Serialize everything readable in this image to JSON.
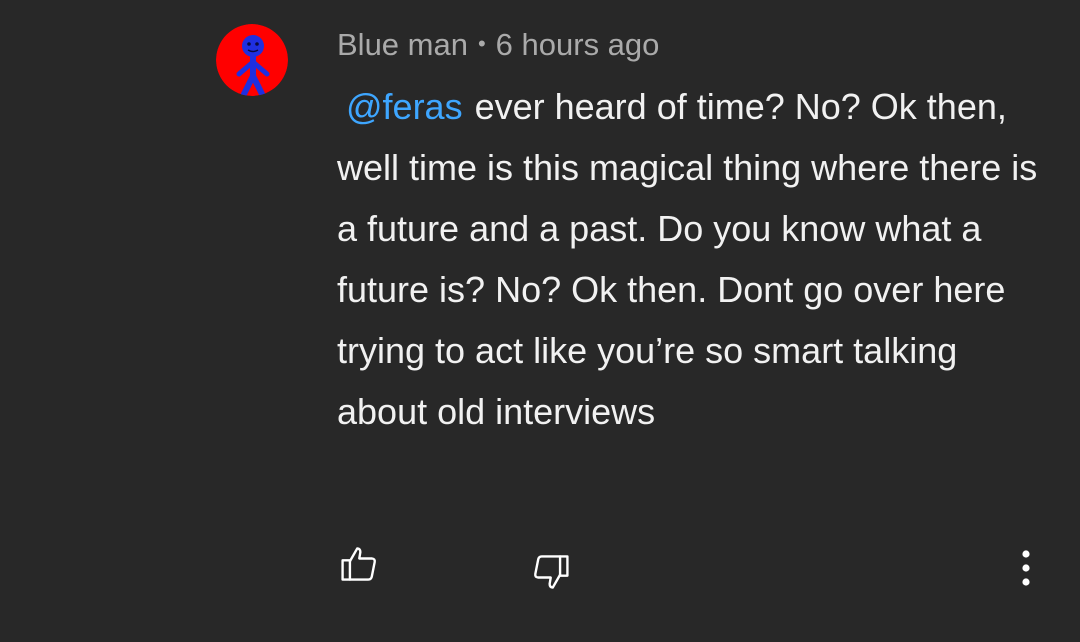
{
  "comment": {
    "author": "Blue man",
    "separator": "•",
    "timestamp": "6 hours ago",
    "mention": "@feras",
    "text": "ever heard of time? No? Ok then, well time is this magical thing where there is a future and a past. Do you know what a future is? No? Ok then. Dont go over here trying to act like you’re so smart talking about old interviews"
  },
  "avatar": {
    "icon": "stick-figure-avatar",
    "background_color": "#ff0000",
    "figure_color": "#1f2fe0"
  },
  "actions": {
    "like_icon": "thumbs-up-icon",
    "dislike_icon": "thumbs-down-icon",
    "more_icon": "more-vertical-icon"
  },
  "colors": {
    "background": "#282828",
    "meta_text": "#aaaaaa",
    "body_text": "#f1f1f1",
    "mention": "#3ea6ff",
    "icon": "#ffffff"
  }
}
